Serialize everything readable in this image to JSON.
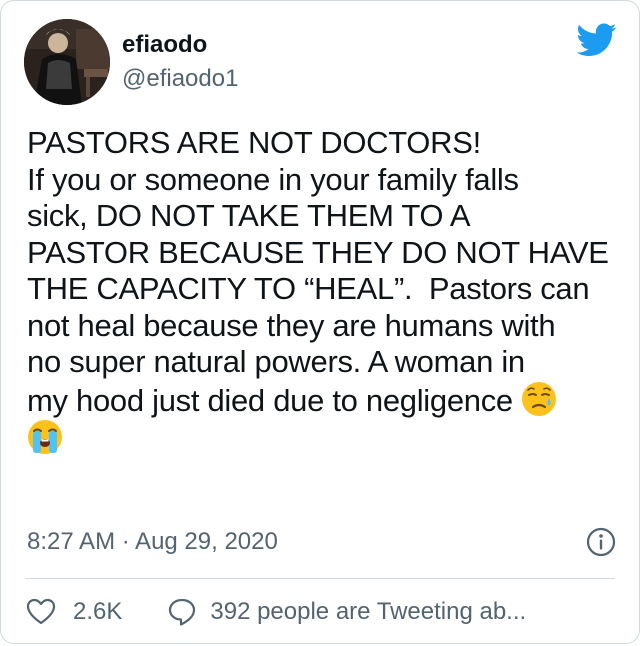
{
  "author": {
    "display_name": "efiaodo",
    "handle": "@efiaodo1",
    "avatar_icon": "profile-photo"
  },
  "brand": {
    "icon": "twitter-bird-icon",
    "color": "#1d9bf0"
  },
  "tweet": {
    "lines": [
      "PASTORS ARE NOT DOCTORS!",
      "If you or someone in your family falls",
      "sick, DO NOT TAKE THEM TO A",
      "PASTOR BECAUSE THEY DO NOT HAVE",
      "THE CAPACITY TO “HEAL”.  Pastors can",
      "not heal because they are humans with",
      "no super natural powers. A woman in",
      "my hood just died due to negligence "
    ],
    "emojis": [
      "sad-relieved-face-emoji",
      "loudly-crying-face-emoji"
    ]
  },
  "meta": {
    "timestamp": "8:27 AM · Aug 29, 2020",
    "info_icon": "info-icon"
  },
  "actions": {
    "like_count": "2.6K",
    "tweeting_text": "392 people are Tweeting ab..."
  },
  "colors": {
    "text": "#0f1419",
    "secondary": "#536471",
    "border": "#cfd9de"
  }
}
